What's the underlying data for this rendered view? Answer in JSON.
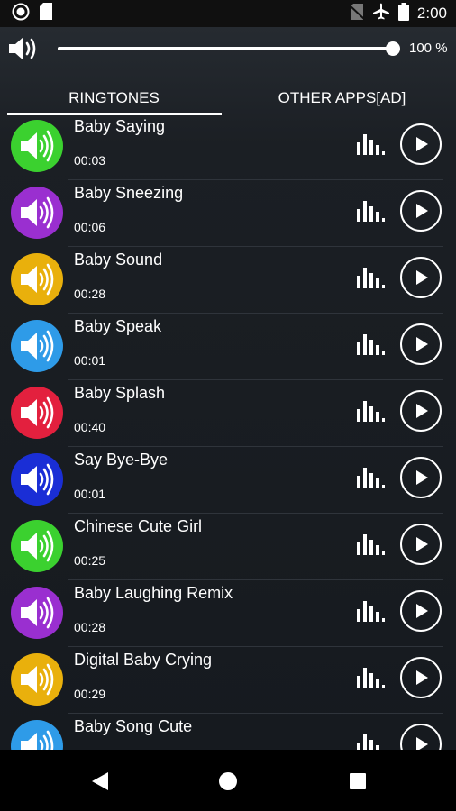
{
  "status_bar": {
    "time": "2:00",
    "left_icons": [
      "record-icon",
      "sd-card-icon"
    ],
    "right_icons": [
      "no-sim-icon",
      "airplane-icon",
      "battery-icon"
    ]
  },
  "volume": {
    "level": 1.0,
    "percent_label": "100 %",
    "icon": "speaker-icon"
  },
  "tabs": [
    {
      "label": "RINGTONES",
      "selected": true
    },
    {
      "label": "OTHER APPS[AD]",
      "selected": false
    }
  ],
  "ringtones": [
    {
      "title": "Baby Saying",
      "duration": "00:03",
      "color": "#3bd12f"
    },
    {
      "title": "Baby Sneezing",
      "duration": "00:06",
      "color": "#9a2fd0"
    },
    {
      "title": "Baby Sound",
      "duration": "00:28",
      "color": "#e9b00c"
    },
    {
      "title": "Baby Speak",
      "duration": "00:01",
      "color": "#2e9be8"
    },
    {
      "title": "Baby Splash",
      "duration": "00:40",
      "color": "#e3203e"
    },
    {
      "title": "Say Bye-Bye",
      "duration": "00:01",
      "color": "#1a2ed6"
    },
    {
      "title": "Chinese Cute Girl",
      "duration": "00:25",
      "color": "#3bd12f"
    },
    {
      "title": "Baby Laughing Remix",
      "duration": "00:28",
      "color": "#9a2fd0"
    },
    {
      "title": "Digital Baby Crying",
      "duration": "00:29",
      "color": "#e9b00c"
    },
    {
      "title": "Baby Song Cute",
      "duration": "",
      "color": "#2e9be8"
    }
  ],
  "nav_bar": [
    "back-icon",
    "home-icon",
    "recents-icon"
  ]
}
